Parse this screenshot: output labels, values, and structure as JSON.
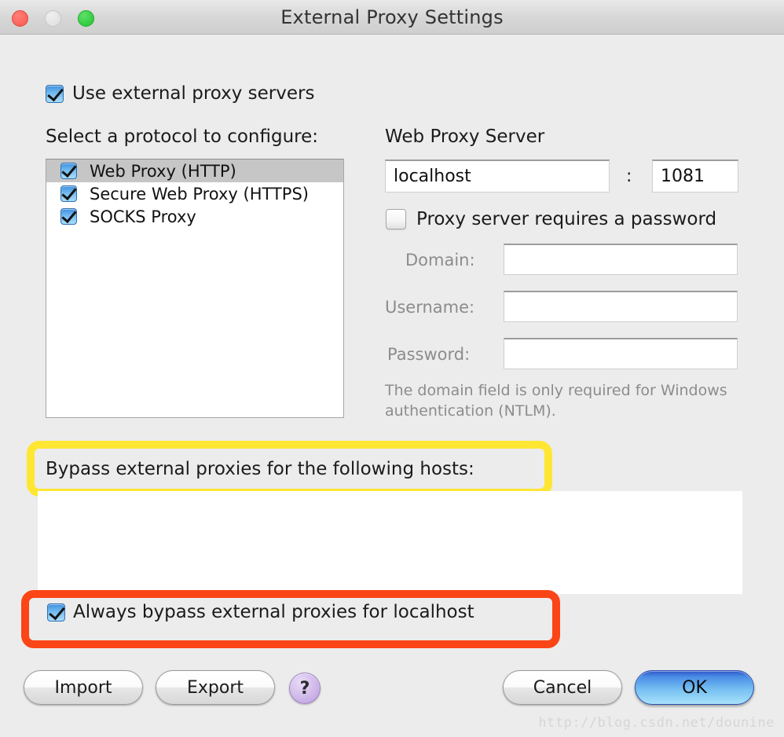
{
  "window": {
    "title": "External Proxy Settings",
    "traffic_lights": [
      {
        "name": "close",
        "color": "#fb564c"
      },
      {
        "name": "minimize",
        "color": "#dcdcdc"
      },
      {
        "name": "maximize",
        "color": "#21c32f"
      }
    ]
  },
  "use_external": {
    "label": "Use external proxy servers",
    "checked": true
  },
  "protocol_section": {
    "heading": "Select a protocol to configure:",
    "items": [
      {
        "label": "Web Proxy (HTTP)",
        "checked": true,
        "selected": true
      },
      {
        "label": "Secure Web Proxy (HTTPS)",
        "checked": true,
        "selected": false
      },
      {
        "label": "SOCKS Proxy",
        "checked": true,
        "selected": false
      }
    ]
  },
  "server_section": {
    "heading": "Web Proxy Server",
    "host_value": "localhost",
    "separator": ":",
    "port_value": "1081",
    "requires_password": {
      "label": "Proxy server requires a password",
      "checked": false
    },
    "fields": [
      {
        "label": "Domain:",
        "value": ""
      },
      {
        "label": "Username:",
        "value": ""
      },
      {
        "label": "Password:",
        "value": ""
      }
    ],
    "hint_line1": "The domain field is only required for Windows",
    "hint_line2": "authentication (NTLM)."
  },
  "bypass_section": {
    "heading": "Bypass external proxies for the following hosts:",
    "hosts_value": "",
    "always_bypass": {
      "label": "Always bypass external proxies for localhost",
      "checked": true
    }
  },
  "highlights": {
    "yellow_color": "#ffe633",
    "red_color": "#fb4516"
  },
  "buttons": {
    "import": "Import",
    "export": "Export",
    "help": "?",
    "cancel": "Cancel",
    "ok": "OK"
  },
  "watermark": "http://blog.csdn.net/dounine"
}
